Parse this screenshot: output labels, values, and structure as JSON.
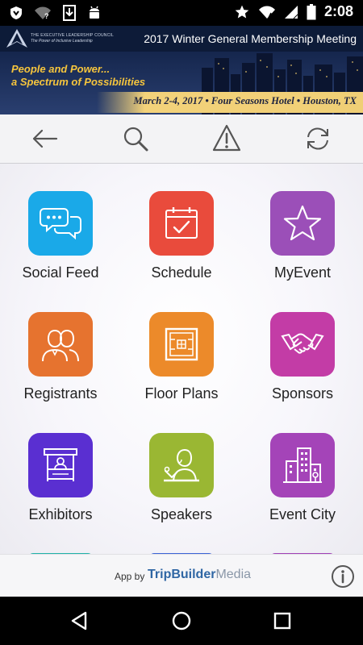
{
  "status_bar": {
    "time": "2:08",
    "icons": [
      "shield-icon",
      "wifi-question-icon",
      "download-icon",
      "android-icon",
      "star-icon",
      "wifi-icon",
      "signal-icon",
      "battery-icon"
    ]
  },
  "banner": {
    "org_line1": "THE EXECUTIVE LEADERSHIP COUNCIL",
    "org_line2": "The Power of Inclusive Leadership",
    "title": "2017 Winter General Membership Meeting",
    "tagline_line1": "People and Power...",
    "tagline_line2": "a Spectrum of Possibilities",
    "date_location": "March 2-4, 2017 • Four Seasons Hotel • Houston, TX"
  },
  "toolbar": {
    "buttons": [
      "back-arrow-icon",
      "search-icon",
      "alert-icon",
      "refresh-icon"
    ]
  },
  "tiles": [
    {
      "label": "Social Feed",
      "color": "#1aa9e8",
      "icon": "chat-bubbles-icon"
    },
    {
      "label": "Schedule",
      "color": "#e94b3c",
      "icon": "calendar-check-icon"
    },
    {
      "label": "MyEvent",
      "color": "#9b4fb8",
      "icon": "star-icon"
    },
    {
      "label": "Registrants",
      "color": "#e6732f",
      "icon": "people-icon"
    },
    {
      "label": "Floor Plans",
      "color": "#ec8a2a",
      "icon": "floor-plan-icon"
    },
    {
      "label": "Sponsors",
      "color": "#c33ca6",
      "icon": "handshake-icon"
    },
    {
      "label": "Exhibitors",
      "color": "#5a2fd1",
      "icon": "booth-icon"
    },
    {
      "label": "Speakers",
      "color": "#9ab733",
      "icon": "speaker-podium-icon"
    },
    {
      "label": "Event City",
      "color": "#a444b8",
      "icon": "city-buildings-icon"
    }
  ],
  "peek_colors": [
    "#1fb2a8",
    "#3a63d6",
    "#a03fb6"
  ],
  "footer": {
    "app_by": "App by",
    "brand_bold": "TripBuilder",
    "brand_light": "Media"
  },
  "nav_bar": {
    "buttons": [
      "back-triangle-icon",
      "home-circle-icon",
      "recents-square-icon"
    ]
  }
}
